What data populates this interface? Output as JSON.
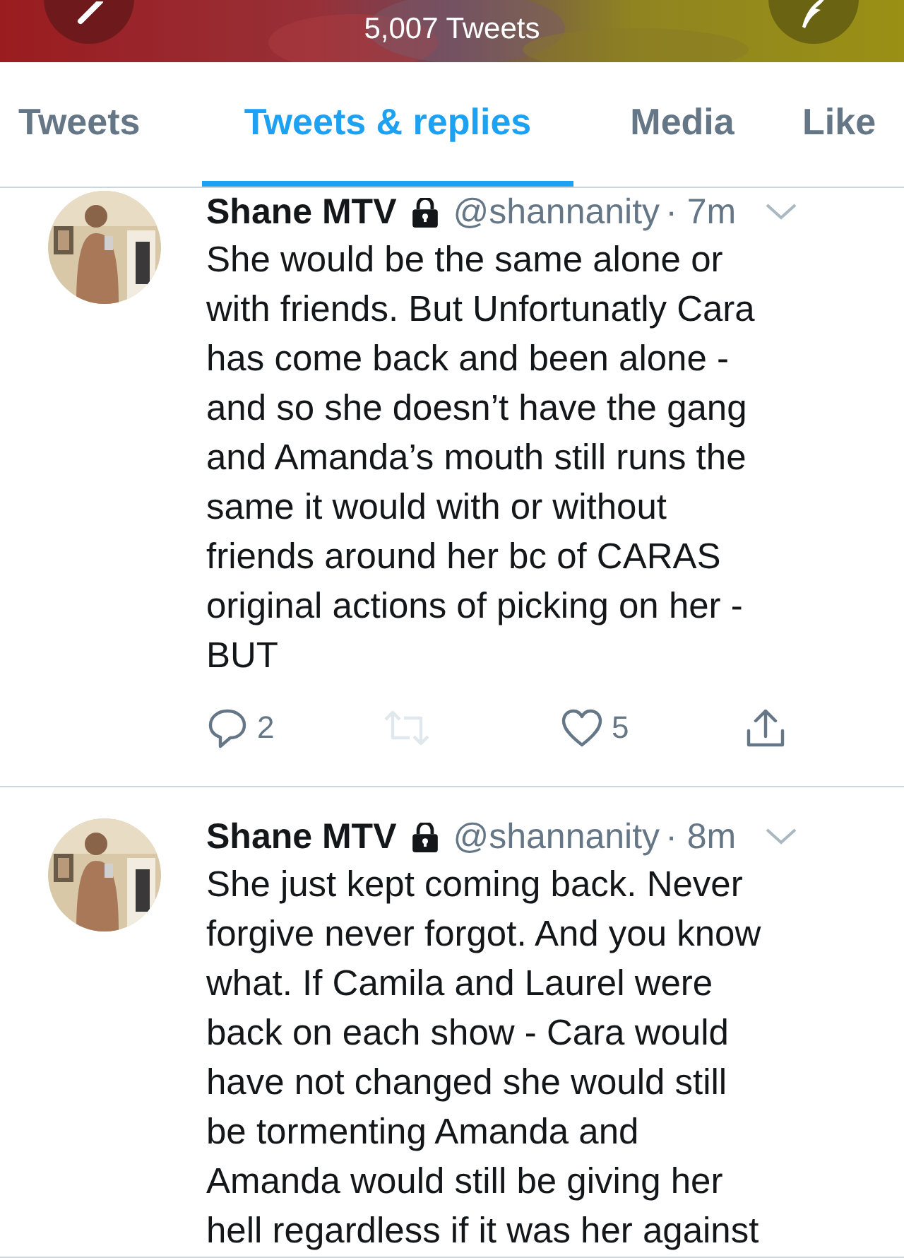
{
  "header": {
    "subtitle": "5,007 Tweets"
  },
  "tabs": [
    {
      "label": "Tweets",
      "selected": false
    },
    {
      "label": "Tweets & replies",
      "selected": true
    },
    {
      "label": "Media",
      "selected": false
    },
    {
      "label": "Like",
      "selected": false
    }
  ],
  "tweets": [
    {
      "name": "Shane MTV",
      "locked": true,
      "handle": "@shannanity",
      "time": "· 7m",
      "text": "She would be the same alone or\nwith friends. But Unfortunatly Cara\nhas come back and been alone -\nand so she doesn’t have the gang\nand Amanda’s mouth still runs the\nsame it would with or without\nfriends around her bc of CARAS\noriginal actions of picking on her  -\nBUT",
      "actions": [
        {
          "kind": "reply",
          "count": "2",
          "disabled": false
        },
        {
          "kind": "retweet",
          "disabled": true
        },
        {
          "kind": "like",
          "count": "5",
          "disabled": false
        },
        {
          "kind": "share",
          "disabled": false
        }
      ]
    },
    {
      "name": "Shane MTV",
      "locked": true,
      "handle": "@shannanity",
      "time": "· 8m",
      "text": "She just kept coming back. Never\nforgive never forgot. And you know\nwhat. If Camila and Laurel were\nback on each show - Cara would\nhave not changed she would still\nbe tormenting Amanda and\nAmanda would still be giving her\nhell regardless if it was her against"
    }
  ]
}
